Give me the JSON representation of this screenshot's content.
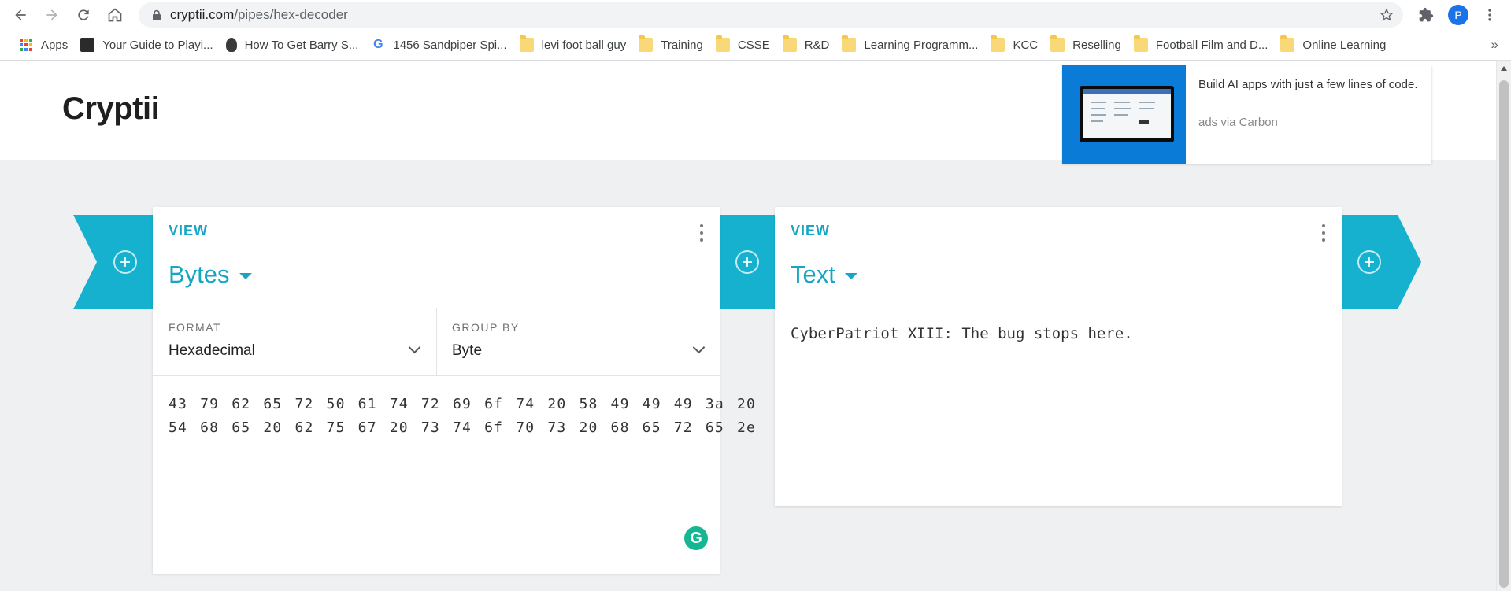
{
  "browser": {
    "url_host": "cryptii.com",
    "url_path": "/pipes/hex-decoder",
    "profile_initial": "P",
    "bookmarks": [
      {
        "label": "Apps",
        "icon": "apps-grid-icon"
      },
      {
        "label": "Your Guide to Playi...",
        "icon": "site-icon"
      },
      {
        "label": "How To Get Barry S...",
        "icon": "site-icon"
      },
      {
        "label": "1456 Sandpiper Spi...",
        "icon": "google-icon"
      },
      {
        "label": "levi foot ball guy",
        "icon": "folder-icon"
      },
      {
        "label": "Training",
        "icon": "folder-icon"
      },
      {
        "label": "CSSE",
        "icon": "folder-icon"
      },
      {
        "label": "R&D",
        "icon": "folder-icon"
      },
      {
        "label": "Learning Programm...",
        "icon": "folder-icon"
      },
      {
        "label": "KCC",
        "icon": "folder-icon"
      },
      {
        "label": "Reselling",
        "icon": "folder-icon"
      },
      {
        "label": "Football Film and D...",
        "icon": "folder-icon"
      },
      {
        "label": "Online Learning",
        "icon": "folder-icon"
      }
    ],
    "more": "»"
  },
  "site": {
    "title": "Cryptii"
  },
  "ad": {
    "headline": "Build AI apps with just a few lines of code.",
    "via": "ads via Carbon"
  },
  "left_card": {
    "label": "VIEW",
    "type": "Bytes",
    "format_label": "FORMAT",
    "format_value": "Hexadecimal",
    "group_label": "GROUP BY",
    "group_value": "Byte",
    "content": "43 79 62 65 72 50 61 74 72 69 6f 74 20 58 49 49 49 3a 20\n54 68 65 20 62 75 67 20 73 74 6f 70 73 20 68 65 72 65 2e"
  },
  "right_card": {
    "label": "VIEW",
    "type": "Text",
    "content": "CyberPatriot XIII: The bug stops here."
  },
  "grammarly": "G",
  "colors": {
    "accent": "#16b1cf",
    "accent_text": "#16a6c4",
    "ad_blue": "#0a7bd6",
    "grammarly": "#14b791"
  }
}
